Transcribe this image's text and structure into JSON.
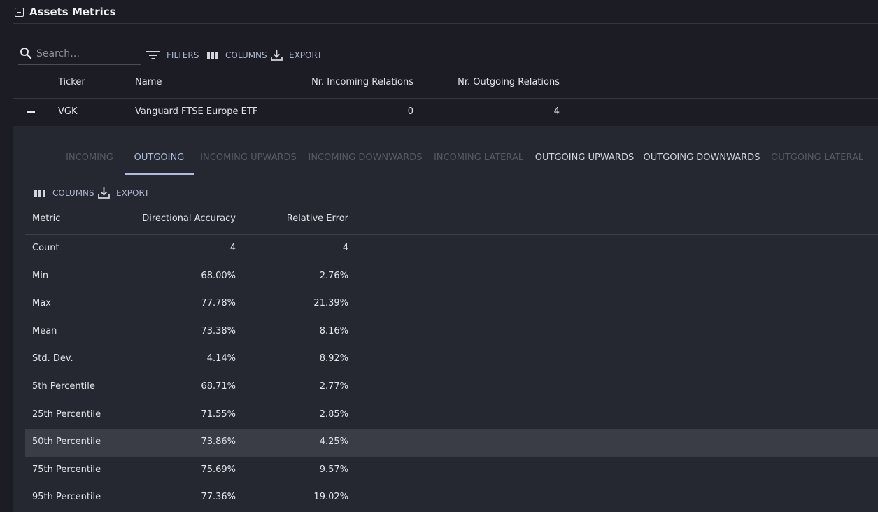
{
  "section": {
    "title": "Assets Metrics"
  },
  "toolbar": {
    "search_placeholder": "Search…",
    "filters_label": "FILTERS",
    "columns_label": "COLUMNS",
    "export_label": "EXPORT"
  },
  "outer_table": {
    "columns": [
      "Ticker",
      "Name",
      "Nr. Incoming Relations",
      "Nr. Outgoing Relations"
    ],
    "rows": [
      {
        "ticker": "VGK",
        "name": "Vanguard FTSE Europe ETF",
        "incoming": "0",
        "outgoing": "4"
      }
    ]
  },
  "tabs": [
    {
      "label": "INCOMING",
      "state": "disabled"
    },
    {
      "label": "OUTGOING",
      "state": "active"
    },
    {
      "label": "INCOMING UPWARDS",
      "state": "disabled"
    },
    {
      "label": "INCOMING DOWNWARDS",
      "state": "disabled"
    },
    {
      "label": "INCOMING LATERAL",
      "state": "disabled"
    },
    {
      "label": "OUTGOING UPWARDS",
      "state": "enabled"
    },
    {
      "label": "OUTGOING DOWNWARDS",
      "state": "enabled"
    },
    {
      "label": "OUTGOING LATERAL",
      "state": "disabled"
    }
  ],
  "inner_toolbar": {
    "columns_label": "COLUMNS",
    "export_label": "EXPORT"
  },
  "metrics_table": {
    "columns": [
      "Metric",
      "Directional Accuracy",
      "Relative Error"
    ],
    "rows": [
      {
        "metric": "Count",
        "accuracy": "4",
        "error": "4"
      },
      {
        "metric": "Min",
        "accuracy": "68.00%",
        "error": "2.76%"
      },
      {
        "metric": "Max",
        "accuracy": "77.78%",
        "error": "21.39%"
      },
      {
        "metric": "Mean",
        "accuracy": "73.38%",
        "error": "8.16%"
      },
      {
        "metric": "Std. Dev.",
        "accuracy": "4.14%",
        "error": "8.92%"
      },
      {
        "metric": "5th Percentile",
        "accuracy": "68.71%",
        "error": "2.77%"
      },
      {
        "metric": "25th Percentile",
        "accuracy": "71.55%",
        "error": "2.85%"
      },
      {
        "metric": "50th Percentile",
        "accuracy": "73.86%",
        "error": "4.25%"
      },
      {
        "metric": "75th Percentile",
        "accuracy": "75.69%",
        "error": "9.57%"
      },
      {
        "metric": "95th Percentile",
        "accuracy": "77.36%",
        "error": "19.02%"
      }
    ],
    "highlighted_row": 7
  }
}
